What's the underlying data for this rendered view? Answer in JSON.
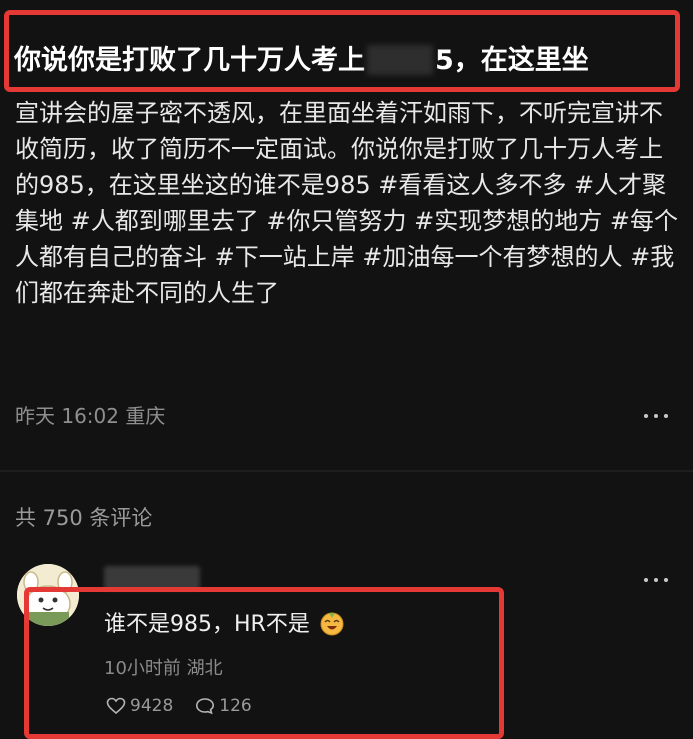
{
  "post": {
    "title_part1": "你说你是打败了几十万人考上",
    "title_part2": "5，在这里坐",
    "body": "宣讲会的屋子密不透风，在里面坐着汗如雨下，不听完宣讲不收简历，收了简历不一定面试。你说你是打败了几十万人考上的985，在这里坐这的谁不是985",
    "hashtags": [
      "#看看这人多不多",
      "#人才聚集地",
      "#人都到哪里去了",
      "#你只管努力",
      "#实现梦想的地方",
      "#每个人都有自己的奋斗",
      "#下一站上岸",
      "#加油每一个有梦想的人",
      "#我们都在奔赴不同的人生了"
    ],
    "time": "昨天 16:02",
    "location": "重庆"
  },
  "comments_header": "共 750 条评论",
  "comment": {
    "text": "谁不是985，HR不是",
    "time": "10小时前",
    "location": "湖北",
    "likes": "9428",
    "replies": "126"
  },
  "icons": {
    "more": "more-dots-icon",
    "like": "heart-icon",
    "reply": "comment-bubble-icon",
    "emoji": "laughing-emoji-icon"
  }
}
